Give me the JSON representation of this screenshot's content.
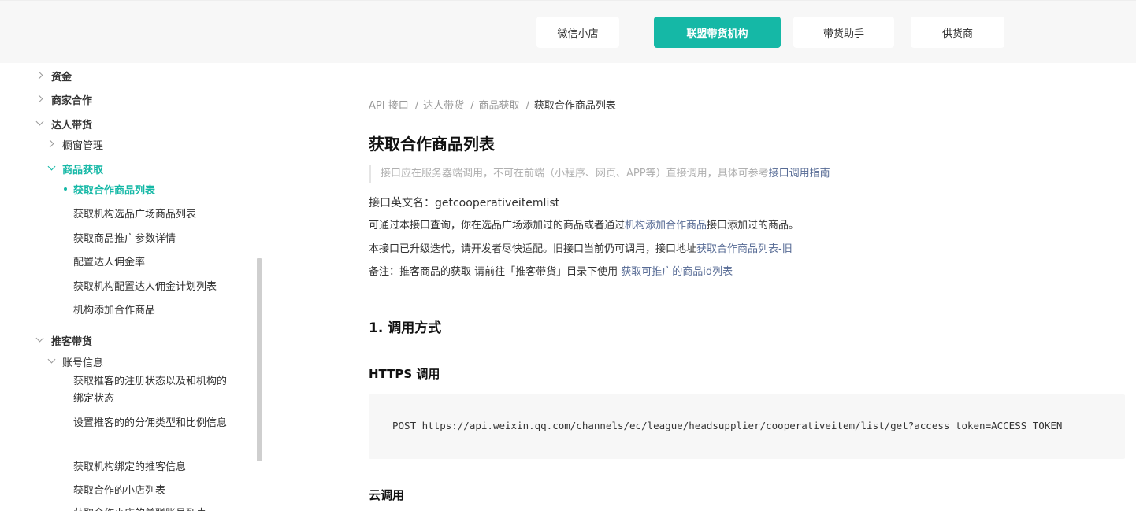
{
  "top_tabs": [
    {
      "label": "微信小店"
    },
    {
      "label": "联盟带货机构"
    },
    {
      "label": "带货助手"
    },
    {
      "label": "供货商"
    }
  ],
  "sidebar": {
    "items": [
      {
        "label": "资金"
      },
      {
        "label": "商家合作"
      },
      {
        "label": "达人带货"
      },
      {
        "label": "橱窗管理"
      },
      {
        "label": "商品获取"
      },
      {
        "label": "获取合作商品列表"
      },
      {
        "label": "获取机构选品广场商品列表"
      },
      {
        "label": "获取商品推广参数详情"
      },
      {
        "label": "配置达人佣金率"
      },
      {
        "label": "获取机构配置达人佣金计划列表"
      },
      {
        "label": "机构添加合作商品"
      },
      {
        "label": "推客带货"
      },
      {
        "label": "账号信息"
      },
      {
        "label": "获取推客的注册状态以及和机构的绑定状态"
      },
      {
        "label": "设置推客的的分佣类型和比例信息"
      },
      {
        "label": "获取机构绑定的推客信息"
      },
      {
        "label": "获取合作的小店列表"
      },
      {
        "label": "获取合作小店的关联账号列表"
      }
    ]
  },
  "breadcrumb": [
    "API 接口",
    "达人带货",
    "商品获取",
    "获取合作商品列表"
  ],
  "page_title": "获取合作商品列表",
  "notice": {
    "text": "接口应在服务器端调用，不可在前端（小程序、网页、APP等）直接调用，具体可参考",
    "link": "接口调用指南"
  },
  "paragraphs": {
    "p1": "接口英文名：getcooperativeitemlist",
    "p2_pre": "可通过本接口查询，你在选品广场添加过的商品或者通过",
    "p2_link": "机构添加合作商品",
    "p2_post": "接口添加过的商品。",
    "p3_pre": "本接口已升级迭代，请开发者尽快适配。旧接口当前仍可调用，接口地址",
    "p3_link": "获取合作商品列表-旧",
    "p4_pre": "备注：推客商品的获取 请前往「推客带货」目录下使用 ",
    "p4_link": "获取可推广的商品id列表"
  },
  "section1_title": "1. 调用方式",
  "https_title": "HTTPS 调用",
  "code": "POST https://api.weixin.qq.com/channels/ec/league/headsupplier/cooperativeitem/list/get?access_token=ACCESS_TOKEN",
  "cloud_title": "云调用",
  "colors": {
    "accent": "#15b8a6",
    "link": "#576b95"
  }
}
